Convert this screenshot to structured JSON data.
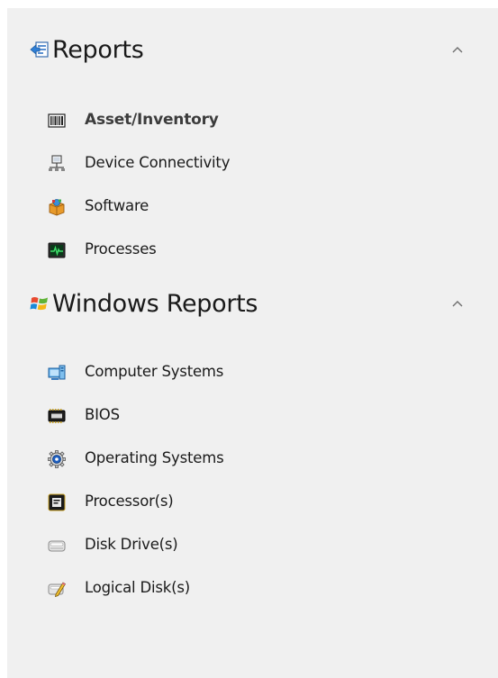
{
  "groups": [
    {
      "title": "Reports",
      "icon": "reports-icon",
      "expanded": true,
      "items": [
        {
          "label": "Asset/Inventory",
          "icon": "barcode-icon",
          "selected": true
        },
        {
          "label": "Device Connectivity",
          "icon": "network-icon"
        },
        {
          "label": "Software",
          "icon": "software-box-icon"
        },
        {
          "label": "Processes",
          "icon": "activity-monitor-icon"
        }
      ]
    },
    {
      "title": "Windows Reports",
      "icon": "windows-logo-icon",
      "expanded": true,
      "items": [
        {
          "label": "Computer Systems",
          "icon": "computer-systems-icon"
        },
        {
          "label": "BIOS",
          "icon": "bios-chip-icon"
        },
        {
          "label": "Operating Systems",
          "icon": "operating-system-gear-icon"
        },
        {
          "label": "Processor(s)",
          "icon": "processor-icon"
        },
        {
          "label": "Disk Drive(s)",
          "icon": "disk-drive-icon"
        },
        {
          "label": "Logical Disk(s)",
          "icon": "logical-disk-icon"
        }
      ]
    }
  ],
  "colors": {
    "panel_background": "#f0f0f0",
    "text": "#1a1a1a",
    "chevron": "#6e6e6e"
  }
}
